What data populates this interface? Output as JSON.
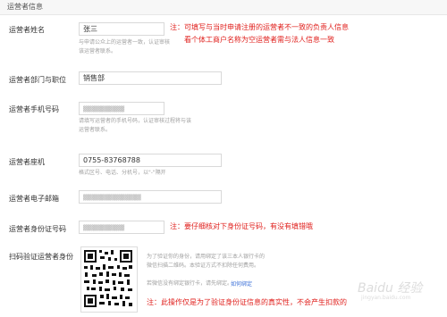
{
  "section_title": "运营者信息",
  "fields": {
    "name": {
      "label": "运营者姓名",
      "value": "张三",
      "hint": "与申请公众上的运营者一致，认证审核",
      "hint2": "该运营者联系。"
    },
    "department": {
      "label": "运营者部门与职位",
      "value": "销售部"
    },
    "phone": {
      "label": "运营者手机号码",
      "hint": "请填写运营者的手机号码，认证审核过程将与该",
      "hint2": "运营者联系。"
    },
    "tel": {
      "label": "运营者座机",
      "value": "0755-83768788",
      "hint": "格式区号、电话、分机号，以\"-\"隔开"
    },
    "email": {
      "label": "运营者电子邮箱"
    },
    "idcard": {
      "label": "运营者身份证号码"
    },
    "verify": {
      "label": "扫码验证运营者身份",
      "hint": "为了验证你的身份，请用绑定了该三本人银行卡的",
      "hint2": "微信扫描二维码。本验证方式不扣除任何费用。",
      "hint3": "若微信没有绑定银行卡，请先绑定。",
      "link": "如何绑定"
    }
  },
  "annotations": {
    "name_note_1": "注：可填写与当时申请注册的运营者不一致的负责人信息",
    "name_note_2": "看个体工商户名称为空运营者需与法人信息一致",
    "idcard_note": "注：要仔细核对下身份证号码，有没有填错哦",
    "verify_note": "注：此操作仅是为了验证身份证信息的真实性，不会产生扣款的"
  },
  "watermark": "Baidu 经验",
  "watermark_sub": "jingyan.baidu.com",
  "colors": {
    "annotation_red": "#e0201d",
    "link_blue": "#3a6fd8"
  }
}
